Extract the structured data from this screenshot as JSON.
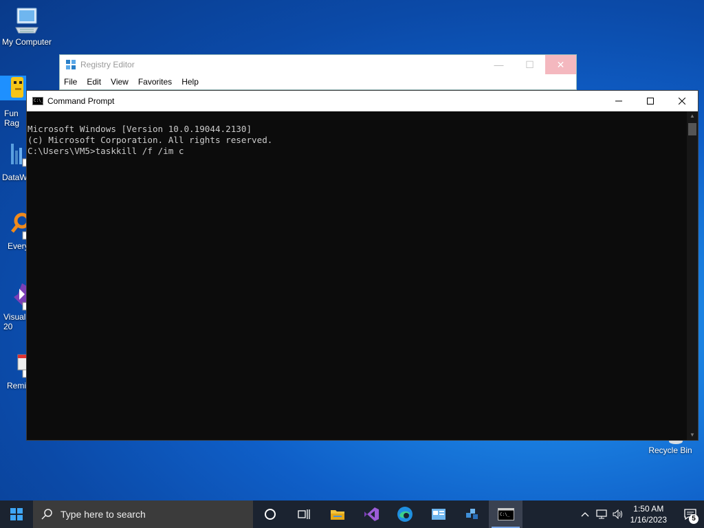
{
  "desktop": {
    "icons": [
      {
        "label": "My Computer"
      },
      {
        "label": "Fun Rag"
      },
      {
        "label": "DataW"
      },
      {
        "label": "Every"
      },
      {
        "label": "Visual 20"
      },
      {
        "label": "Remi"
      },
      {
        "label": "Recycle Bin"
      }
    ]
  },
  "regedit": {
    "title": "Registry Editor",
    "menu": [
      "File",
      "Edit",
      "View",
      "Favorites",
      "Help"
    ]
  },
  "cmd": {
    "title": "Command Prompt",
    "icon_text": "C:\\_",
    "lines": [
      "Microsoft Windows [Version 10.0.19044.2130]",
      "(c) Microsoft Corporation. All rights reserved.",
      "",
      "C:\\Users\\VM5>taskkill /f /im c"
    ]
  },
  "taskbar": {
    "search_placeholder": "Type here to search",
    "clock_time": "1:50 AM",
    "clock_date": "1/16/2023",
    "notification_count": "5"
  },
  "colors": {
    "accent": "#0f5fc8",
    "taskbar": "#1b2330",
    "console_bg": "#0c0c0c",
    "console_fg": "#cccccc"
  }
}
